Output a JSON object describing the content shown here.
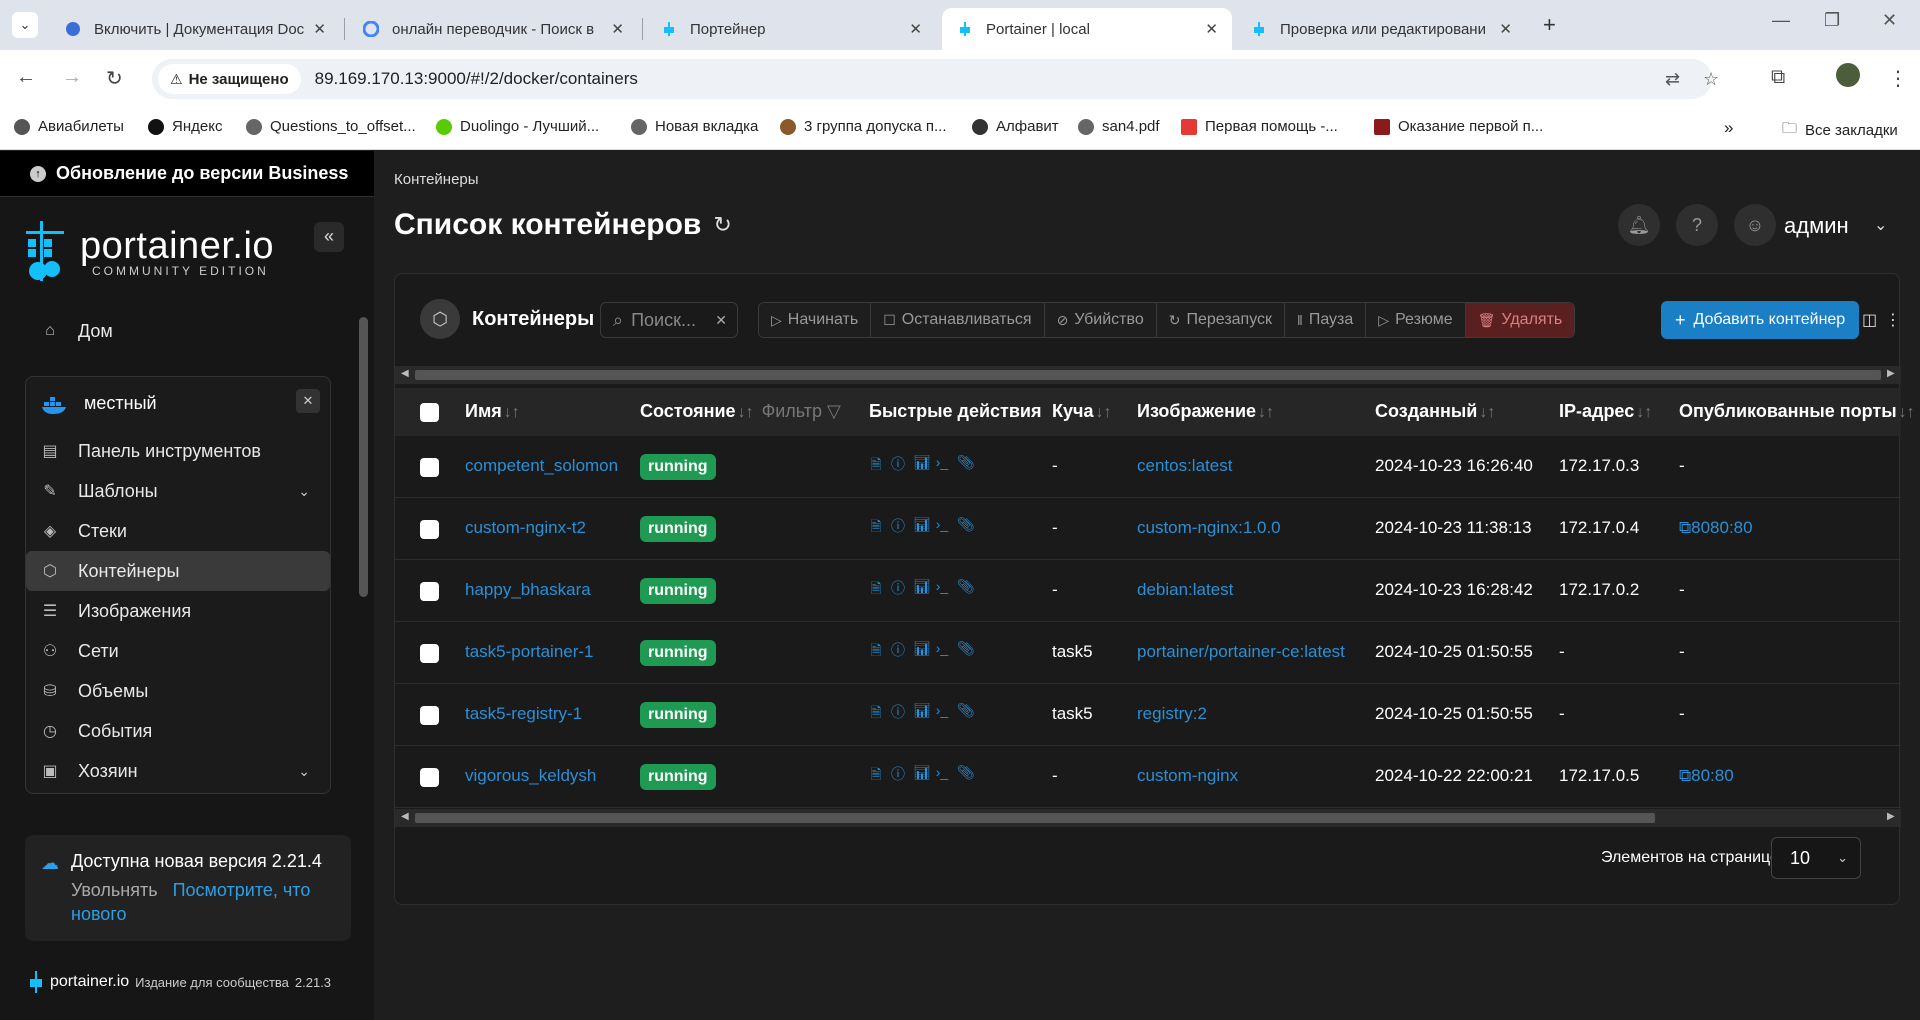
{
  "browser": {
    "tabs": [
      {
        "title": "Включить | Документация Doc",
        "icon": "docker-docs-icon"
      },
      {
        "title": "онлайн переводчик - Поиск в",
        "icon": "google-icon"
      },
      {
        "title": "Портейнер",
        "icon": "portainer-icon"
      },
      {
        "title": "Portainer | local",
        "icon": "portainer-icon"
      },
      {
        "title": "Проверка или редактировани",
        "icon": "portainer-icon"
      }
    ],
    "security_label": "Не защищено",
    "url": "89.169.170.13:9000/#!/2/docker/containers",
    "bookmarks": [
      "Авиабилеты",
      "Яндекс",
      "Questions_to_offset...",
      "Duolingo - Лучший...",
      "Новая вкладка",
      "3 группа допуска п...",
      "Алфавит",
      "san4.pdf",
      "Первая помощь -...",
      "Оказание первой п..."
    ],
    "all_bookmarks": "Все закладки"
  },
  "sidebar": {
    "upgrade": "Обновление до версии Business",
    "logo_main": "portainer.io",
    "logo_sub": "COMMUNITY EDITION",
    "home": "Дом",
    "env_name": "местный",
    "items": [
      "Панель инструментов",
      "Шаблоны",
      "Стеки",
      "Контейнеры",
      "Изображения",
      "Сети",
      "Объемы",
      "События",
      "Хозяин"
    ],
    "update_title": "Доступна новая версия 2.21.4",
    "update_dismiss": "Увольнять",
    "update_link": "Посмотрите, что нового",
    "footer_brand": "portainer.io",
    "footer_edition": "Издание для сообщества",
    "footer_version": "2.21.3"
  },
  "main": {
    "breadcrumb": "Контейнеры",
    "title": "Список контейнеров",
    "user": "админ",
    "panel_title": "Контейнеры",
    "search_placeholder": "Поиск...",
    "actions": [
      "Начинать",
      "Останавливаться",
      "Убийство",
      "Перезапуск",
      "Пауза",
      "Резюме",
      "Удалять"
    ],
    "add_button": "Добавить контейнер",
    "columns": {
      "name": "Имя",
      "state": "Состояние",
      "filter": "Фильтр",
      "quick": "Быстрые действия",
      "stack": "Куча",
      "image": "Изображение",
      "created": "Созданный",
      "ip": "IP-адрес",
      "ports": "Опубликованные порты"
    },
    "rows": [
      {
        "name": "competent_solomon",
        "state": "running",
        "stack": "-",
        "image": "centos:latest",
        "created": "2024-10-23 16:26:40",
        "ip": "172.17.0.3",
        "ports": "-"
      },
      {
        "name": "custom-nginx-t2",
        "state": "running",
        "stack": "-",
        "image": "custom-nginx:1.0.0",
        "created": "2024-10-23 11:38:13",
        "ip": "172.17.0.4",
        "ports": "8080:80"
      },
      {
        "name": "happy_bhaskara",
        "state": "running",
        "stack": "-",
        "image": "debian:latest",
        "created": "2024-10-23 16:28:42",
        "ip": "172.17.0.2",
        "ports": "-"
      },
      {
        "name": "task5-portainer-1",
        "state": "running",
        "stack": "task5",
        "image": "portainer/portainer-ce:latest",
        "created": "2024-10-25 01:50:55",
        "ip": "-",
        "ports": "-"
      },
      {
        "name": "task5-registry-1",
        "state": "running",
        "stack": "task5",
        "image": "registry:2",
        "created": "2024-10-25 01:50:55",
        "ip": "-",
        "ports": "-"
      },
      {
        "name": "vigorous_keldysh",
        "state": "running",
        "stack": "-",
        "image": "custom-nginx",
        "created": "2024-10-22 22:00:21",
        "ip": "172.17.0.5",
        "ports": "80:80"
      }
    ],
    "per_page_label": "Элементов на странице",
    "per_page": "10"
  },
  "colors": {
    "accent": "#1a7fc4",
    "running": "#1f9a52",
    "link": "#2b8fd6",
    "danger": "#5a1f1f"
  }
}
